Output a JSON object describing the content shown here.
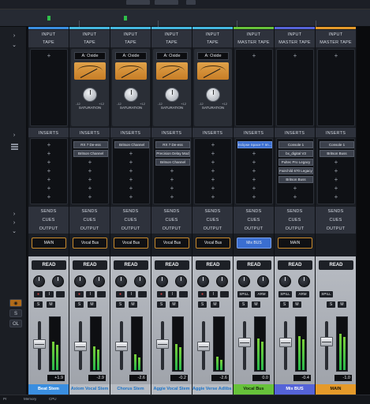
{
  "sections": {
    "input": "INPUT",
    "tape": "TAPE",
    "master_tape": "MASTER TAPE",
    "inserts": "INSERTS",
    "sends": "SENDS",
    "cues": "CUES",
    "output": "OUTPUT"
  },
  "tape": {
    "model": "A: Oxide",
    "knob_label": "SATURATION",
    "min": "-12",
    "max": "+12"
  },
  "left_buttons": {
    "s": "S",
    "ol": "OL"
  },
  "buttons": {
    "read": "READ",
    "i": "I",
    "s": "S",
    "m": "M",
    "spill": "SPILL",
    "arm": "ARM"
  },
  "bottom_status": {
    "left1": "Pr",
    "left2": "Memory",
    "left3": "CPU"
  },
  "channels": [
    {
      "name": "Beat Stem",
      "color": "#3a8ee0",
      "type": "track",
      "inserts": [],
      "output": "MAIN",
      "output_blue": false,
      "gain": "+1.9",
      "meter": 0.55,
      "fader": 0.55,
      "name_bg": "#3a8ee0",
      "name_fg": "#ffffff"
    },
    {
      "name": "Axiom Vocal Stem",
      "color": "#45b8e0",
      "type": "track",
      "inserts": [
        "RX 7 De-ess",
        "Britson Channel"
      ],
      "output": "Vocal Bus",
      "output_blue": false,
      "gain": "-2.9",
      "meter": 0.45,
      "fader": 0.5,
      "name_bg": "#b8bcc3",
      "name_fg": "#1a73c9"
    },
    {
      "name": "Chorus Stem",
      "color": "#45b8e0",
      "type": "track",
      "inserts": [
        "Britson Channel"
      ],
      "output": "Vocal Bus",
      "output_blue": false,
      "gain": "-2.6",
      "meter": 0.3,
      "fader": 0.5,
      "name_bg": "#b8bcc3",
      "name_fg": "#1a73c9"
    },
    {
      "name": "Aggie Vocal Stem",
      "color": "#45b8e0",
      "type": "track",
      "inserts": [
        "RX 7 De-ess",
        "Precision Delay Mod",
        "Britson Channel"
      ],
      "output": "Vocal Bus",
      "output_blue": false,
      "gain": "-0.2",
      "meter": 0.5,
      "fader": 0.55,
      "name_bg": "#b8bcc3",
      "name_fg": "#1a73c9"
    },
    {
      "name": "Aggie Verse Adlibs Stem",
      "color": "#45b8e0",
      "type": "track",
      "inserts": [],
      "output": "Vocal Bus",
      "output_blue": false,
      "gain": "-2.6",
      "meter": 0.25,
      "fader": 0.5,
      "name_bg": "#b8bcc3",
      "name_fg": "#1a73c9"
    },
    {
      "name": "Vocal Bus",
      "color": "#67c23a",
      "type": "bus",
      "inserts": [
        "Eclipse Space T Im..."
      ],
      "output": "Mix BUS",
      "output_blue": true,
      "gain": "0.0",
      "meter": 0.6,
      "fader": 0.6,
      "name_bg": "#67c23a",
      "name_fg": "#15230c"
    },
    {
      "name": "Mix BUS",
      "color": "#5563d8",
      "type": "bus",
      "inserts": [
        "Console 1",
        "bx_digital V3",
        "Pultec Pro Legacy",
        "Fairchild 670 Legacy",
        "Britson Buss"
      ],
      "output": "MAIN",
      "output_blue": false,
      "gain": "-0.4",
      "meter": 0.65,
      "fader": 0.6,
      "name_bg": "#5563d8",
      "name_fg": "#ffffff"
    },
    {
      "name": "MAIN",
      "color": "#e59a2a",
      "type": "main",
      "inserts": [
        "Console 1",
        "Britson Buss"
      ],
      "output": "",
      "output_blue": false,
      "gain": "-1.0",
      "meter": 0.7,
      "fader": 0.62,
      "name_bg": "#e59a2a",
      "name_fg": "#1b1203"
    }
  ]
}
